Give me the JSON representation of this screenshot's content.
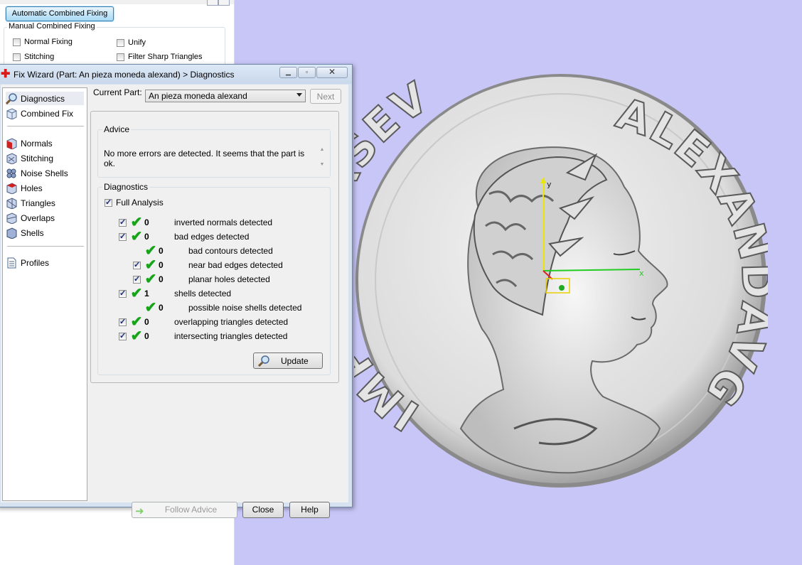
{
  "background_panel": {
    "auto_fix_label": "Automatic Combined Fixing",
    "manual_group_label": "Manual Combined Fixing",
    "checks": [
      {
        "label": "Normal Fixing",
        "checked": false
      },
      {
        "label": "Unify",
        "checked": false
      },
      {
        "label": "Stitching",
        "checked": false
      },
      {
        "label": "Filter Sharp Triangles",
        "checked": false
      }
    ]
  },
  "window": {
    "title": "Fix Wizard (Part: An pieza moneda alexand) > Diagnostics",
    "nav": [
      {
        "label": "Diagnostics",
        "icon": "magnifier-icon",
        "selected": true
      },
      {
        "label": "Combined Fix",
        "icon": "cube-stack-icon",
        "selected": false
      },
      {
        "label": "Normals",
        "icon": "normals-cube-icon",
        "selected": false
      },
      {
        "label": "Stitching",
        "icon": "stitching-cube-icon",
        "selected": false
      },
      {
        "label": "Noise Shells",
        "icon": "noise-shells-icon",
        "selected": false
      },
      {
        "label": "Holes",
        "icon": "holes-cube-icon",
        "selected": false
      },
      {
        "label": "Triangles",
        "icon": "triangles-cube-icon",
        "selected": false
      },
      {
        "label": "Overlaps",
        "icon": "overlaps-cube-icon",
        "selected": false
      },
      {
        "label": "Shells",
        "icon": "shells-cube-icon",
        "selected": false
      },
      {
        "label": "Profiles",
        "icon": "document-icon",
        "selected": false
      }
    ],
    "current_part_label": "Current Part:",
    "current_part_value": "An pieza moneda alexand",
    "next_label": "Next",
    "advice_label": "Advice",
    "advice_text": "No more errors are detected. It seems that the part is ok.",
    "diagnostics_label": "Diagnostics",
    "full_analysis_label": "Full Analysis",
    "diagnostics": [
      {
        "count": "0",
        "label": "inverted normals detected",
        "checkbox": true,
        "checked": true,
        "indent": 0
      },
      {
        "count": "0",
        "label": "bad edges detected",
        "checkbox": true,
        "checked": true,
        "indent": 0
      },
      {
        "count": "0",
        "label": "bad contours detected",
        "checkbox": false,
        "checked": false,
        "indent": 1
      },
      {
        "count": "0",
        "label": "near bad edges detected",
        "checkbox": true,
        "checked": true,
        "indent": 1
      },
      {
        "count": "0",
        "label": "planar holes detected",
        "checkbox": true,
        "checked": true,
        "indent": 1
      },
      {
        "count": "1",
        "label": "shells detected",
        "checkbox": true,
        "checked": true,
        "indent": 0
      },
      {
        "count": "0",
        "label": "possible noise shells detected",
        "checkbox": false,
        "checked": false,
        "indent": 1
      },
      {
        "count": "0",
        "label": "overlapping triangles detected",
        "checkbox": true,
        "checked": true,
        "indent": 0
      },
      {
        "count": "0",
        "label": "intersecting triangles detected",
        "checkbox": true,
        "checked": true,
        "indent": 0
      }
    ],
    "update_label": "Update",
    "follow_advice_label": "Follow Advice",
    "close_label": "Close",
    "help_label": "Help"
  },
  "viewport": {
    "coin_inscription_top": "IMPCMAVRSEV",
    "coin_inscription_right": "ALEXANDAVG",
    "axis_labels": {
      "x": "x",
      "y": "y"
    },
    "colors": {
      "background": "#c7c6f7",
      "x_axis": "#22cc22",
      "y_axis": "#e8e800"
    }
  }
}
